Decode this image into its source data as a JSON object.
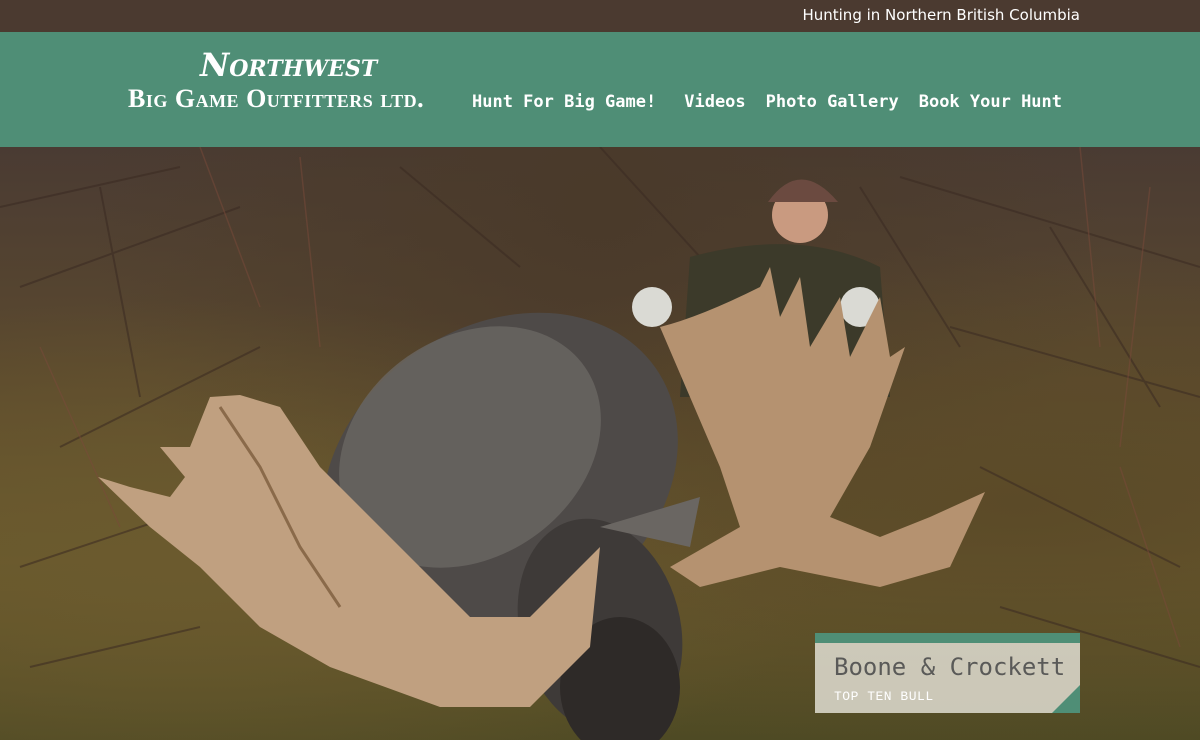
{
  "topbar": {
    "tagline": "Hunting in Northern British Columbia"
  },
  "logo": {
    "line1": "Northwest",
    "line2": "Big Game Outfitters ltd."
  },
  "nav": {
    "items": [
      {
        "label": "Hunt For Big Game!"
      },
      {
        "label": "Videos"
      },
      {
        "label": "Photo Gallery"
      },
      {
        "label": "Book Your Hunt"
      }
    ]
  },
  "hero": {
    "caption": {
      "title": "Boone & Crockett",
      "subtitle": "TOP TEN BULL"
    }
  },
  "colors": {
    "topbar": "#4b3a30",
    "header": "#4f8e76",
    "accent": "#4f8e76"
  }
}
